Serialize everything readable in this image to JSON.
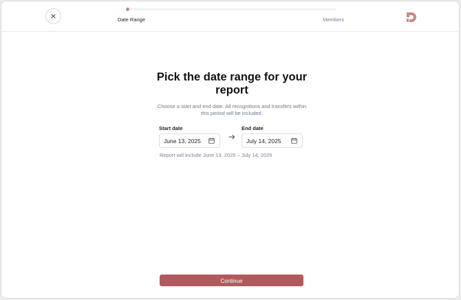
{
  "header": {
    "steps": [
      {
        "label": "Date Range",
        "active": true
      },
      {
        "label": "Members",
        "active": false
      }
    ],
    "progress_fraction": 0.0
  },
  "main": {
    "title": "Pick the date range for your report",
    "subtitle": "Choose a start and end date. All recognitions and transfers within this period will be included.",
    "start_date": {
      "label": "Start date",
      "value": "June 13, 2025"
    },
    "end_date": {
      "label": "End date",
      "value": "July 14, 2025"
    },
    "range_note": "Report will include June 13, 2025 – July 14, 2025"
  },
  "footer": {
    "continue_label": "Continue"
  },
  "colors": {
    "accent": "#b15a5d",
    "progress_dot": "#c7868b",
    "muted_text": "#6f7687"
  },
  "icons": {
    "close": "close-icon",
    "calendar": "calendar-icon",
    "arrow": "arrow-right-icon",
    "logo": "brand-logo-icon"
  }
}
